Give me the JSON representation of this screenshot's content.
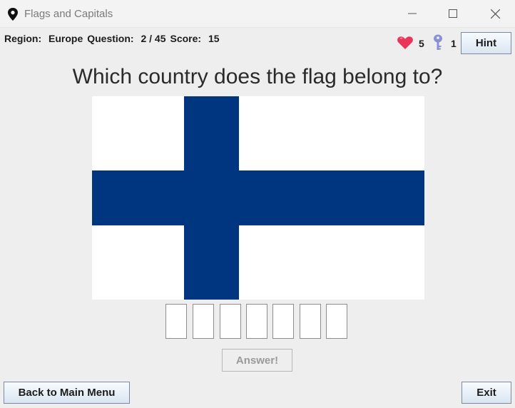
{
  "window": {
    "title": "Flags and Capitals",
    "icons": {
      "app": "location-pin-icon",
      "minimize": "minimize-icon",
      "maximize": "maximize-icon",
      "close": "close-icon"
    }
  },
  "status": {
    "region_label": "Region:",
    "region_value": "Europe",
    "question_label": "Question:",
    "question_value": "2 / 45",
    "score_label": "Score:",
    "score_value": "15",
    "lives": "5",
    "keys": "1",
    "icons": {
      "lives": "heart-icon",
      "keys": "key-icon"
    }
  },
  "toolbar": {
    "hint_label": "Hint"
  },
  "quiz": {
    "question": "Which country does the flag belong to?",
    "flag": {
      "colors": {
        "field": "#ffffff",
        "cross": "#003580"
      }
    },
    "answer_slots": [
      "",
      "",
      "",
      "",
      "",
      "",
      ""
    ],
    "answer_label": "Answer!"
  },
  "footer": {
    "back_label": "Back to Main Menu",
    "exit_label": "Exit"
  }
}
